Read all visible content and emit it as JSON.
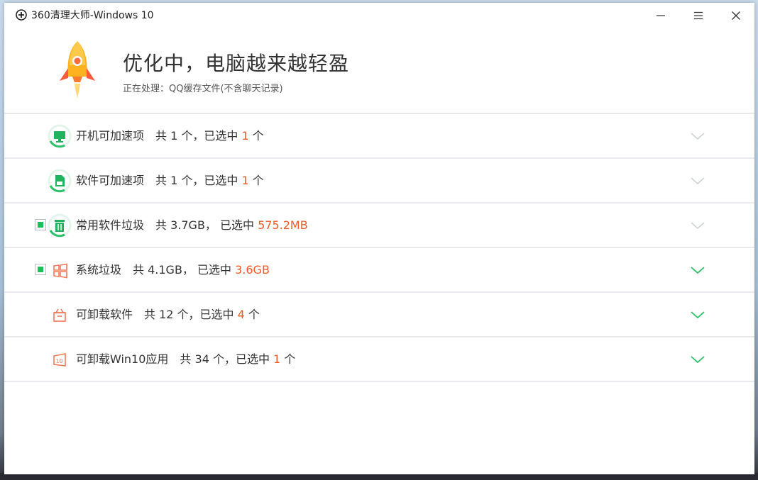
{
  "window": {
    "title": "360清理大师-Windows 10",
    "buttons": [
      "minimize",
      "menu",
      "close"
    ]
  },
  "header": {
    "title": "优化中，电脑越来越轻盈",
    "subtitle": "正在处理：QQ缓存文件(不含聊天记录)"
  },
  "rows": [
    {
      "name": "开机可加速项",
      "total_label": "共 1 个，已选中 ",
      "selected": "1",
      "suffix": " 个",
      "icon": "monitor-icon",
      "checkbox": false,
      "expanded_color": "#cfd3d6"
    },
    {
      "name": "软件可加速项",
      "total_label": "共 1 个，已选中 ",
      "selected": "1",
      "suffix": " 个",
      "icon": "sd-card-icon",
      "checkbox": false,
      "expanded_color": "#cfd3d6"
    },
    {
      "name": "常用软件垃圾",
      "total_label": "共 3.7GB， 已选中 ",
      "selected": "575.2MB",
      "suffix": "",
      "icon": "trash-icon",
      "checkbox": true,
      "expanded_color": "#cfd3d6"
    },
    {
      "name": "系统垃圾",
      "total_label": "共 4.1GB， 已选中 ",
      "selected": "3.6GB",
      "suffix": "",
      "icon": "windows-icon",
      "checkbox": true,
      "expanded_color": "#2fc06b"
    },
    {
      "name": "可卸载软件",
      "total_label": "共 12 个，已选中 ",
      "selected": "4",
      "suffix": " 个",
      "icon": "gift-box-icon",
      "checkbox": false,
      "expanded_color": "#2fc06b"
    },
    {
      "name": "可卸载Win10应用",
      "total_label": "共 34 个，已选中 ",
      "selected": "1",
      "suffix": " 个",
      "icon": "win10-app-icon",
      "checkbox": false,
      "expanded_color": "#2fc06b"
    }
  ],
  "colors": {
    "accent": "#18c15b",
    "selected": "#f05a28"
  }
}
